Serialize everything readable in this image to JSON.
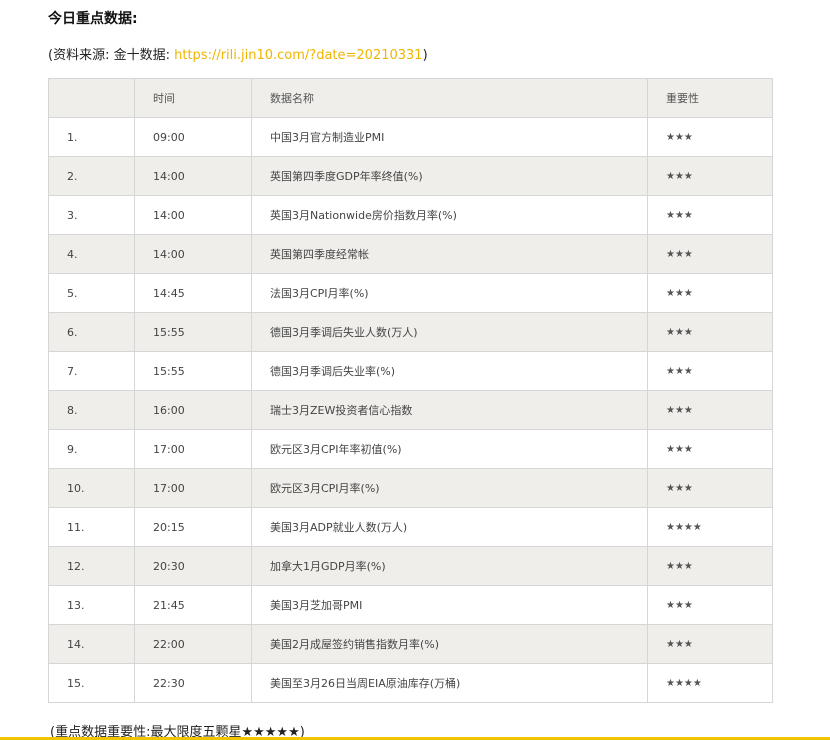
{
  "heading": "今日重点数据:",
  "source": {
    "prefix": "(资料来源: 金十数据: ",
    "link_text": "https://rili.jin10.com/?date=20210331",
    "suffix": ")"
  },
  "table": {
    "headers": [
      "",
      "时间",
      "数据名称",
      "重要性"
    ],
    "rows": [
      {
        "idx": "1.",
        "time": "09:00",
        "name": "中国3月官方制造业PMI",
        "importance": "★★★"
      },
      {
        "idx": "2.",
        "time": "14:00",
        "name": "英国第四季度GDP年率终值(%)",
        "importance": "★★★"
      },
      {
        "idx": "3.",
        "time": "14:00",
        "name": "英国3月Nationwide房价指数月率(%)",
        "importance": "★★★"
      },
      {
        "idx": "4.",
        "time": "14:00",
        "name": "英国第四季度经常帐",
        "importance": "★★★"
      },
      {
        "idx": "5.",
        "time": "14:45",
        "name": "法国3月CPI月率(%)",
        "importance": "★★★"
      },
      {
        "idx": "6.",
        "time": "15:55",
        "name": "德国3月季调后失业人数(万人)",
        "importance": "★★★"
      },
      {
        "idx": "7.",
        "time": "15:55",
        "name": "德国3月季调后失业率(%)",
        "importance": "★★★"
      },
      {
        "idx": "8.",
        "time": "16:00",
        "name": "瑞士3月ZEW投资者信心指数",
        "importance": "★★★"
      },
      {
        "idx": "9.",
        "time": "17:00",
        "name": "欧元区3月CPI年率初值(%)",
        "importance": "★★★"
      },
      {
        "idx": "10.",
        "time": "17:00",
        "name": "欧元区3月CPI月率(%)",
        "importance": "★★★"
      },
      {
        "idx": "11.",
        "time": "20:15",
        "name": "美国3月ADP就业人数(万人)",
        "importance": "★★★★"
      },
      {
        "idx": "12.",
        "time": "20:30",
        "name": "加拿大1月GDP月率(%)",
        "importance": "★★★"
      },
      {
        "idx": "13.",
        "time": "21:45",
        "name": "美国3月芝加哥PMI",
        "importance": "★★★"
      },
      {
        "idx": "14.",
        "time": "22:00",
        "name": "美国2月成屋签约销售指数月率(%)",
        "importance": "★★★"
      },
      {
        "idx": "15.",
        "time": "22:30",
        "name": "美国至3月26日当周EIA原油库存(万桶)",
        "importance": "★★★★"
      }
    ]
  },
  "note": "(重点数据重要性:最大限度五颗星★★★★★)",
  "colors": {
    "link": "#f0b500",
    "row_alt": "#efeeea",
    "accent_rule": "#f2c300"
  }
}
